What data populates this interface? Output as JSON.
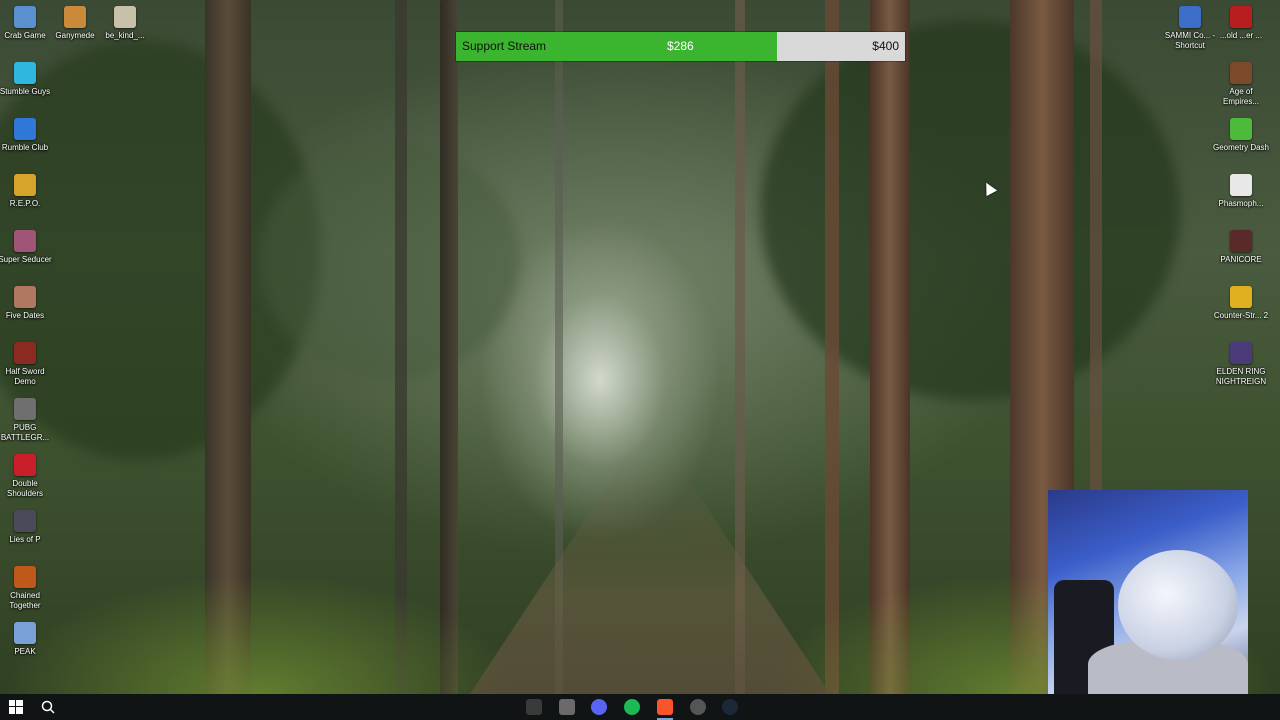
{
  "donation_bar": {
    "title": "Support Stream",
    "raised": "$286",
    "goal": "$400",
    "progress_fraction": 0.715,
    "fill_color": "#3bb52f"
  },
  "desktop_icons_left": [
    {
      "label": "Crab Game",
      "icon": "crab-game-icon",
      "color": "#5a8fd0"
    },
    {
      "label": "Ganymede",
      "icon": "ganymede-icon",
      "color": "#c98b3a"
    },
    {
      "label": "be_kind_...",
      "icon": "file-icon",
      "color": "#c8c0a8"
    },
    {
      "label": "Stumble Guys",
      "icon": "stumble-guys-icon",
      "color": "#2fb7e0"
    },
    {
      "label": "Rumble Club",
      "icon": "rumble-club-icon",
      "color": "#2f78d8"
    },
    {
      "label": "R.E.P.O.",
      "icon": "repo-icon",
      "color": "#d6a42a"
    },
    {
      "label": "Super Seducer",
      "icon": "super-seducer-icon",
      "color": "#a05577"
    },
    {
      "label": "Five Dates",
      "icon": "five-dates-icon",
      "color": "#b07860"
    },
    {
      "label": "Half Sword Demo",
      "icon": "half-sword-icon",
      "color": "#8a2a20"
    },
    {
      "label": "PUBG BATTLEGR...",
      "icon": "pubg-icon",
      "color": "#6f6f6f"
    },
    {
      "label": "Double Shoulders",
      "icon": "double-shoulders-icon",
      "color": "#c81f2b"
    },
    {
      "label": "Lies of P",
      "icon": "lies-of-p-icon",
      "color": "#4a4a5a"
    },
    {
      "label": "Chained Together",
      "icon": "chained-together-icon",
      "color": "#c0581c"
    },
    {
      "label": "PEAK",
      "icon": "peak-icon",
      "color": "#7aa0d8"
    }
  ],
  "desktop_icons_right": [
    {
      "label": "SAMMI Co... - Shortcut",
      "icon": "sammi-icon",
      "color": "#3d6ec7"
    },
    {
      "label": "...old ...er ...",
      "icon": "stronghold-icon",
      "color": "#b81e1e"
    },
    {
      "label": "Age of Empires...",
      "icon": "age-of-empires-icon",
      "color": "#7a4a2a"
    },
    {
      "label": "Geometry Dash",
      "icon": "geometry-dash-icon",
      "color": "#4cba3a"
    },
    {
      "label": "Phasmoph...",
      "icon": "phasmophobia-icon",
      "color": "#e8e8e8"
    },
    {
      "label": "PANICORE",
      "icon": "panicore-icon",
      "color": "#5a2a2a"
    },
    {
      "label": "Counter-Str... 2",
      "icon": "counter-strike-icon",
      "color": "#e0b020"
    },
    {
      "label": "ELDEN RING NIGHTREIGN",
      "icon": "elden-ring-icon",
      "color": "#4a3a7a"
    }
  ],
  "taskbar": {
    "start_icon": "windows-start-icon",
    "search_icon": "search-icon",
    "apps": [
      {
        "name": "obs",
        "icon": "obs-icon",
        "color": "#3a3a3a"
      },
      {
        "name": "file-explorer",
        "icon": "terminal-icon",
        "color": "#6a6a6a"
      },
      {
        "name": "discord",
        "icon": "discord-icon",
        "color": "#5865f2"
      },
      {
        "name": "spotify",
        "icon": "spotify-icon",
        "color": "#1db954"
      },
      {
        "name": "brave",
        "icon": "brave-icon",
        "color": "#fb542b"
      },
      {
        "name": "obs-record",
        "icon": "recording-icon",
        "color": "#555555"
      },
      {
        "name": "steam",
        "icon": "steam-icon",
        "color": "#1b2838"
      }
    ]
  },
  "webcam_overlay": {
    "icon": "webcam-feed"
  }
}
